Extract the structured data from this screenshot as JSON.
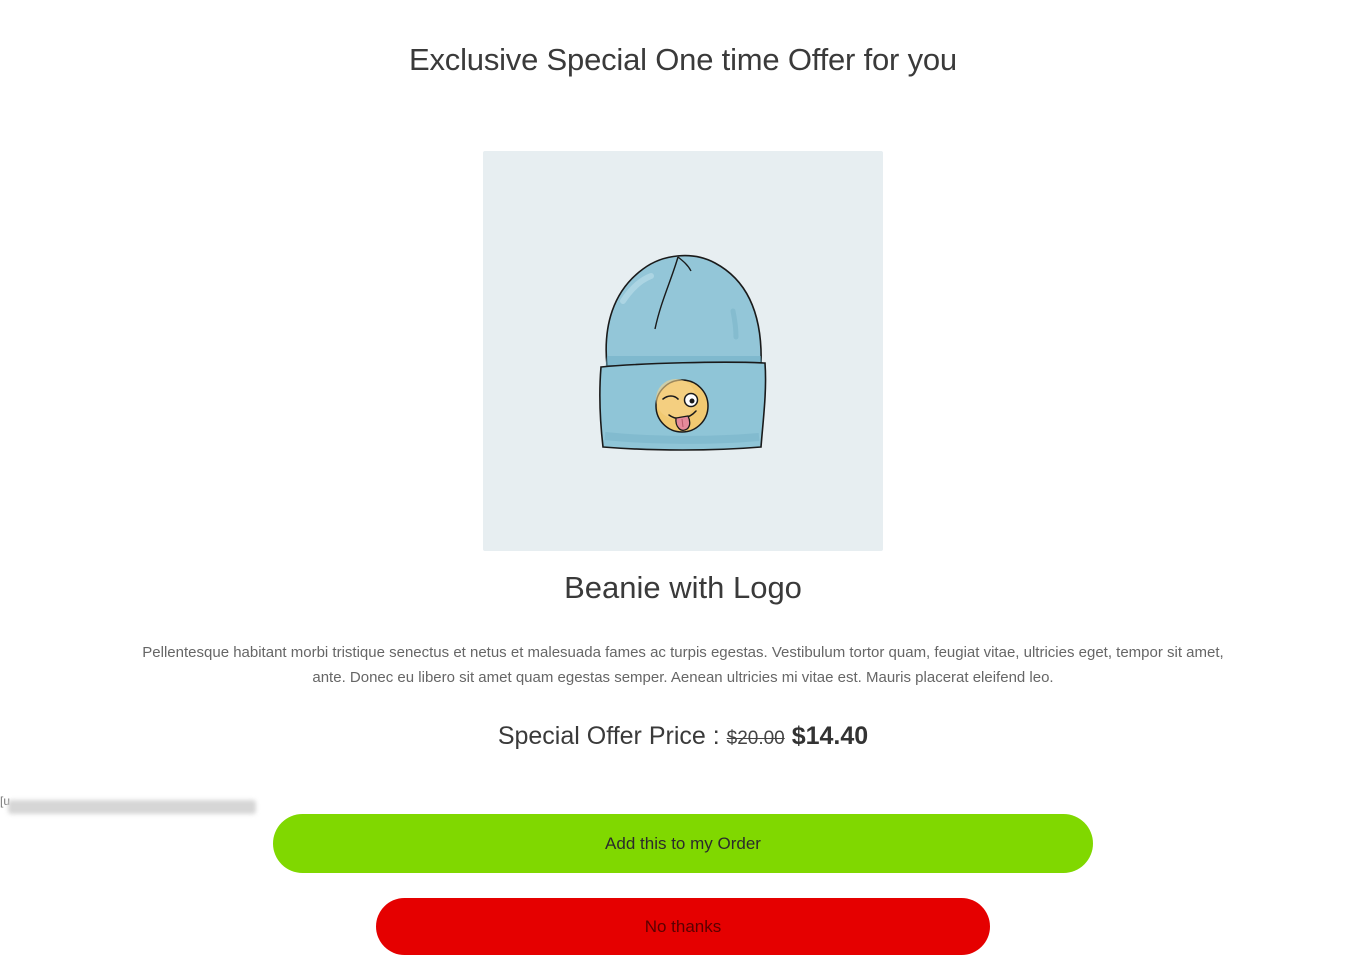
{
  "offer": {
    "headline": "Exclusive Special One time Offer for you",
    "product_image": {
      "icon": "beanie-with-winking-emoji-icon",
      "background_color": "#e7eef1"
    },
    "product_title": "Beanie with Logo",
    "description": "Pellentesque habitant morbi tristique senectus et netus et malesuada fames ac turpis egestas. Vestibulum tortor quam, feugiat vitae, ultricies eget, tempor sit amet, ante. Donec eu libero sit amet quam egestas semper. Aenean ultricies mi vitae est. Mauris placerat eleifend leo.",
    "price": {
      "label": "Special Offer Price :",
      "original": "$20.00",
      "sale": "$14.40"
    },
    "ghost_bracket": "[u"
  },
  "actions": {
    "accept_label": "Add this to my Order",
    "accept_color": "#80d800",
    "decline_label": "No thanks",
    "decline_color": "#e50000"
  }
}
